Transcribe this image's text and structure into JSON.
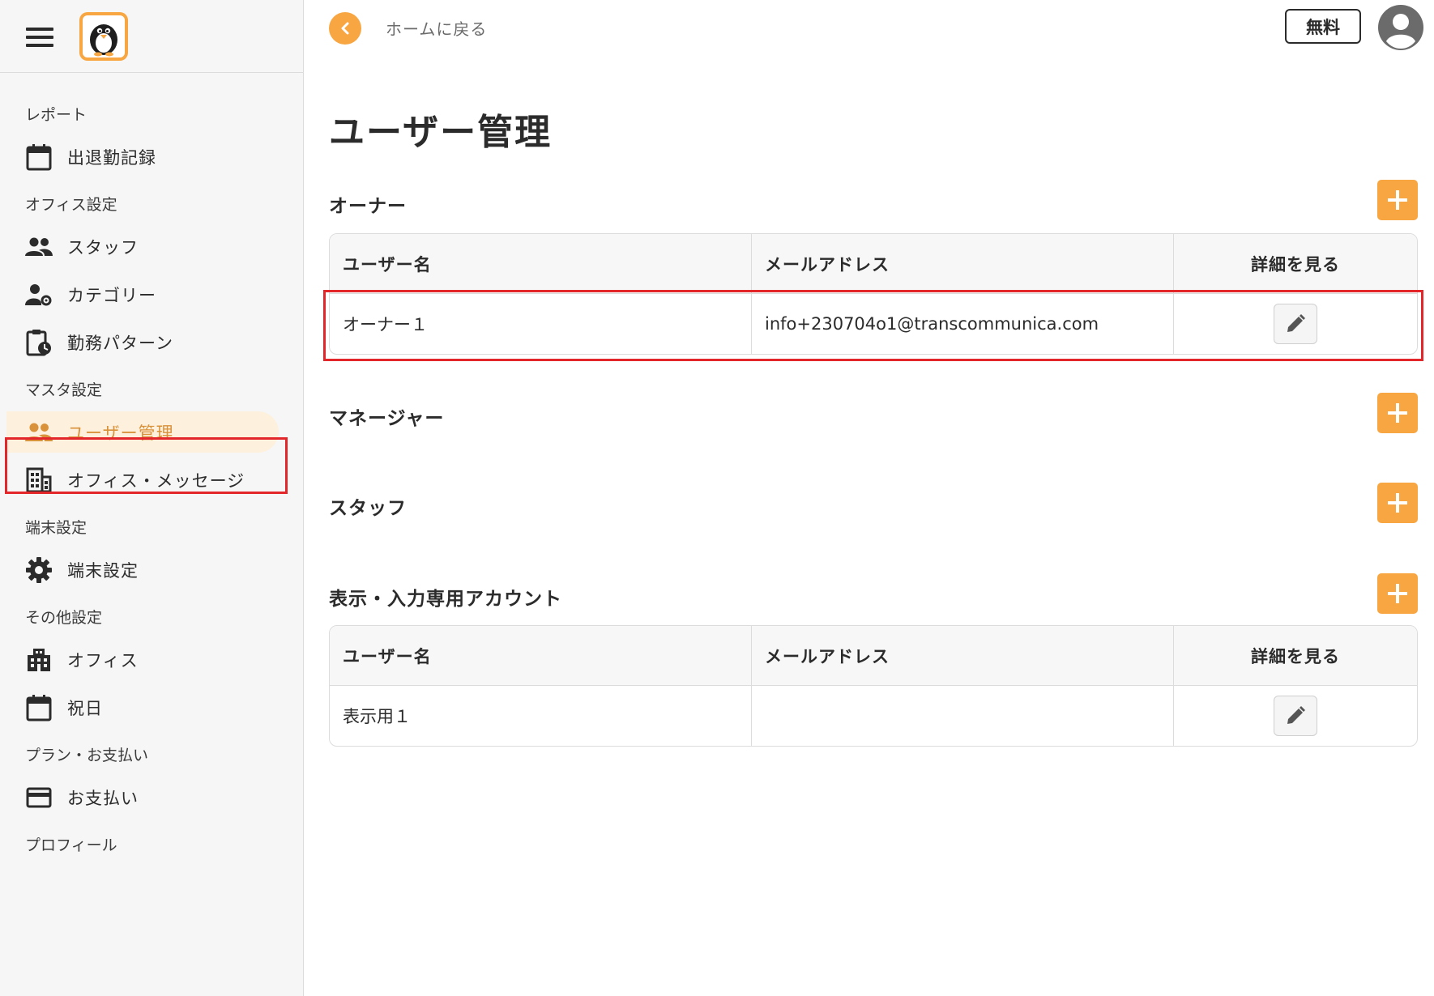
{
  "sidebar": {
    "sections": [
      {
        "title": "レポート",
        "items": [
          {
            "label": "出退勤記録",
            "icon": "calendar-icon"
          }
        ]
      },
      {
        "title": "オフィス設定",
        "items": [
          {
            "label": "スタッフ",
            "icon": "people-icon"
          },
          {
            "label": "カテゴリー",
            "icon": "person-gear-icon"
          },
          {
            "label": "勤務パターン",
            "icon": "clipboard-clock-icon"
          }
        ]
      },
      {
        "title": "マスタ設定",
        "items": [
          {
            "label": "ユーザー管理",
            "icon": "people-icon",
            "active": true
          },
          {
            "label": "オフィス・メッセージ",
            "icon": "building-icon"
          }
        ]
      },
      {
        "title": "端末設定",
        "items": [
          {
            "label": "端末設定",
            "icon": "gear-icon"
          }
        ]
      },
      {
        "title": "その他設定",
        "items": [
          {
            "label": "オフィス",
            "icon": "office-building-icon"
          },
          {
            "label": "祝日",
            "icon": "calendar-icon"
          }
        ]
      },
      {
        "title": "プラン・お支払い",
        "items": [
          {
            "label": "お支払い",
            "icon": "credit-card-icon"
          }
        ]
      },
      {
        "title": "プロフィール",
        "items": []
      }
    ]
  },
  "topbar": {
    "back_label": "ホームに戻る",
    "plan_badge": "無料"
  },
  "main": {
    "title": "ユーザー管理",
    "columns": {
      "name": "ユーザー名",
      "email": "メールアドレス",
      "detail": "詳細を見る"
    },
    "groups": {
      "owner": {
        "title": "オーナー",
        "rows": [
          {
            "name": "オーナー１",
            "email": "info+230704o1@transcommunica.com"
          }
        ]
      },
      "manager": {
        "title": "マネージャー"
      },
      "staff": {
        "title": "スタッフ"
      },
      "viewer": {
        "title": "表示・入力専用アカウント",
        "rows": [
          {
            "name": "表示用１",
            "email": ""
          }
        ]
      }
    }
  },
  "colors": {
    "accent": "#f7a642",
    "active_bg": "#fdf0dc",
    "active_text": "#d9913a",
    "highlight": "#e3262a"
  }
}
